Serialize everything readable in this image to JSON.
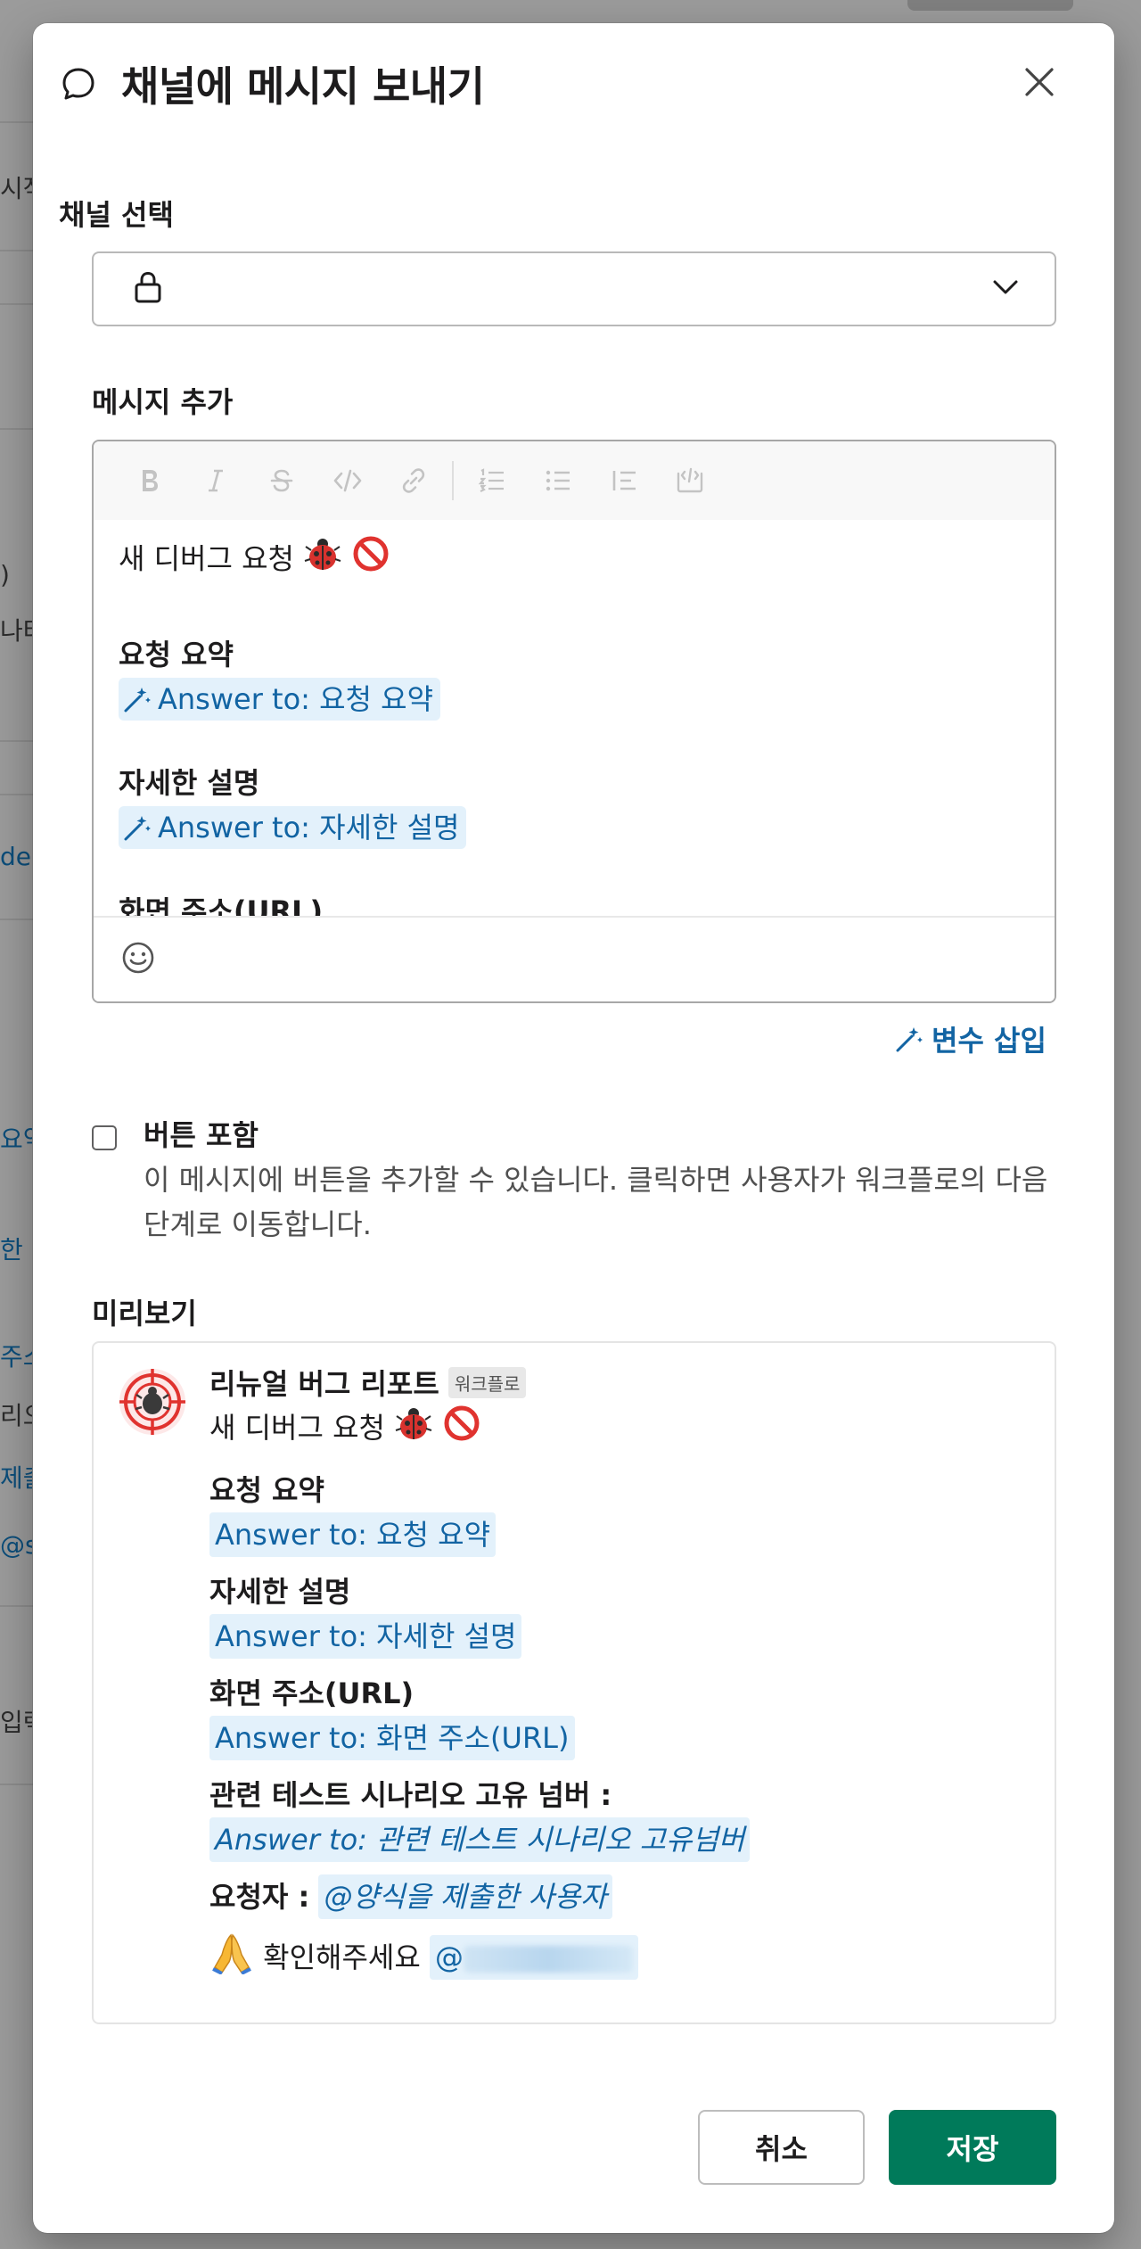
{
  "dialog": {
    "title": "채널에 메시지 보내기",
    "icon": "chat-bubble-icon",
    "close_icon": "close-icon"
  },
  "channel": {
    "label": "채널 선택",
    "icon": "lock-icon",
    "selected": ""
  },
  "message": {
    "label": "메시지 추가",
    "toolbar": [
      "bold",
      "italic",
      "strikethrough",
      "code",
      "link",
      "ordered-list",
      "bullet-list",
      "quote",
      "code-block"
    ],
    "lines": {
      "intro": "새 디버그 요청",
      "summary_heading": "요청 요약",
      "summary_var": "Answer to: 요청 요약",
      "detail_heading": "자세한 설명",
      "detail_var": "Answer to: 자세한 설명",
      "url_heading_partial": "화면 주소(URL)"
    },
    "insert_variable": "변수 삽입"
  },
  "include_button": {
    "title": "버튼 포함",
    "description": "이 메시지에 버튼을 추가할 수 있습니다. 클릭하면 사용자가 워크플로의 다음 단계로 이동합니다.",
    "checked": false
  },
  "preview": {
    "label": "미리보기",
    "sender": "리뉴얼 버그 리포트",
    "badge": "워크플로",
    "intro": "새 디버그 요청",
    "summary_heading": "요청 요약",
    "summary_var": "Answer to: 요청 요약",
    "detail_heading": "자세한 설명",
    "detail_var": "Answer to: 자세한 설명",
    "url_heading": "화면 주소(URL)",
    "url_var": "Answer to: 화면 주소(URL)",
    "scenario_label": "관련 테스트 시나리오 고유 넘버 :",
    "scenario_var": "Answer to: 관련 테스트 시나리오 고유넘버",
    "requester_label": "요청자 :",
    "requester_var": "@양식을 제출한 사용자",
    "confirm_text": "확인해주세요",
    "mention_prefix": "@"
  },
  "actions": {
    "cancel": "취소",
    "save": "저장"
  },
  "colors": {
    "primary_button": "#007a5a",
    "link": "#1264a3",
    "variable_bg": "#e3f1fb"
  }
}
